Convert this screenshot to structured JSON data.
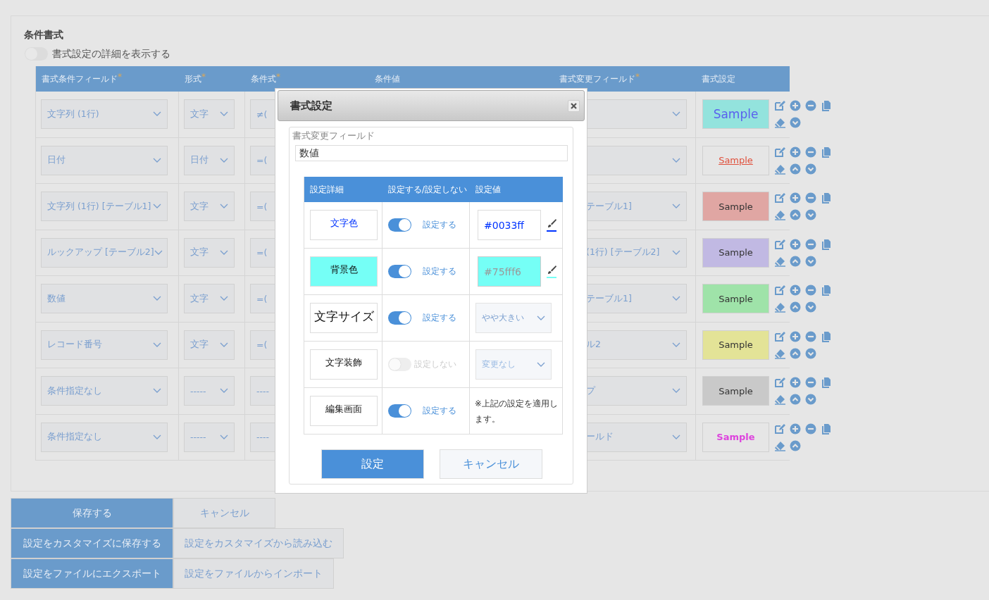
{
  "section_title": "条件書式",
  "detail_toggle": {
    "label": "書式設定の詳細を表示する",
    "on": false
  },
  "table": {
    "columns": [
      {
        "label": "書式条件フィールド",
        "mark": "*"
      },
      {
        "label": "形式",
        "mark": "*"
      },
      {
        "label": "条件式",
        "mark": "*"
      },
      {
        "label": "条件値"
      },
      {
        "label": "書式変更フィールド",
        "mark": "*"
      },
      {
        "label": "書式設定"
      }
    ],
    "rows": [
      {
        "condition_field": "文字列 (1行)",
        "format": "文字",
        "operator": "≠(",
        "target_field": "",
        "sample": {
          "text": "Sample",
          "kind": "large_blue",
          "color": "#93e3dd"
        },
        "can_move_up": false,
        "can_move_down": true
      },
      {
        "condition_field": "日付",
        "format": "日付",
        "operator": "=(",
        "target_field": "",
        "sample": {
          "text": "Sample",
          "kind": "underline_red"
        },
        "can_move_up": true,
        "can_move_down": true
      },
      {
        "condition_field": "文字列 (1行) [テーブル1]",
        "format": "文字",
        "operator": "=(",
        "target_field": "テーブル1]",
        "sample": {
          "text": "Sample",
          "kind": "plain",
          "color": "#e0a6a3"
        },
        "can_move_up": true,
        "can_move_down": true
      },
      {
        "condition_field": "ルックアップ [テーブル2]",
        "format": "文字",
        "operator": "=(",
        "target_field": "(1行) [テーブル2]",
        "sample": {
          "text": "Sample",
          "kind": "plain",
          "color": "#c1b9e3"
        },
        "can_move_up": true,
        "can_move_down": true
      },
      {
        "condition_field": "数値",
        "format": "文字",
        "operator": "=(",
        "target_field": "テーブル1]",
        "sample": {
          "text": "Sample",
          "kind": "plain",
          "color": "#9fe3a9"
        },
        "can_move_up": true,
        "can_move_down": true
      },
      {
        "condition_field": "レコード番号",
        "format": "文字",
        "operator": "=(",
        "target_field": "ル2",
        "sample": {
          "text": "Sample",
          "kind": "plain",
          "color": "#e3e397"
        },
        "can_move_up": true,
        "can_move_down": true
      },
      {
        "condition_field": "条件指定なし",
        "format": "-----",
        "operator": "----",
        "target_field": "プ",
        "sample": {
          "text": "Sample",
          "kind": "plain",
          "color": "#c9c9c9"
        },
        "can_move_up": true,
        "can_move_down": true
      },
      {
        "condition_field": "条件指定なし",
        "format": "-----",
        "operator": "----",
        "target_field": "ールド",
        "sample": {
          "text": "Sample",
          "kind": "bold_magenta"
        },
        "can_move_up": true,
        "can_move_down": false
      }
    ]
  },
  "dialog": {
    "title": "書式設定",
    "field_label": "書式変更フィールド",
    "field_value": "数値",
    "columns": [
      "設定詳細",
      "設定する/設定しない",
      "設定値"
    ],
    "rows": [
      {
        "label": "文字色",
        "on": true,
        "state_label": "設定する",
        "kind": "text_color",
        "value": "#0033ff",
        "color": "#0033ff"
      },
      {
        "label": "背景色",
        "on": true,
        "state_label": "設定する",
        "kind": "background_color",
        "value": "#75fff6",
        "color": "#75fff6"
      },
      {
        "label": "文字サイズ",
        "on": true,
        "state_label": "設定する",
        "kind": "size",
        "value": "やや大きい"
      },
      {
        "label": "文字装飾",
        "on": false,
        "state_label": "設定しない",
        "kind": "decoration",
        "value": "変更なし"
      },
      {
        "label": "編集画面",
        "on": true,
        "state_label": "設定する",
        "kind": "note",
        "value": "※上記の設定を適用します。"
      }
    ],
    "buttons": [
      {
        "label": "設定",
        "primary": true
      },
      {
        "label": "キャンセル",
        "primary": false
      }
    ]
  },
  "buttons": [
    [
      {
        "label": "保存する",
        "primary": true
      },
      {
        "label": "キャンセル",
        "primary": false
      }
    ],
    [
      {
        "label": "設定をカスタマイズに保存する",
        "primary": true
      },
      {
        "label": "設定をカスタマイズから読み込む",
        "primary": false
      }
    ],
    [
      {
        "label": "設定をファイルにエクスポート",
        "primary": true
      },
      {
        "label": "設定をファイルからインポート",
        "primary": false
      }
    ]
  ]
}
